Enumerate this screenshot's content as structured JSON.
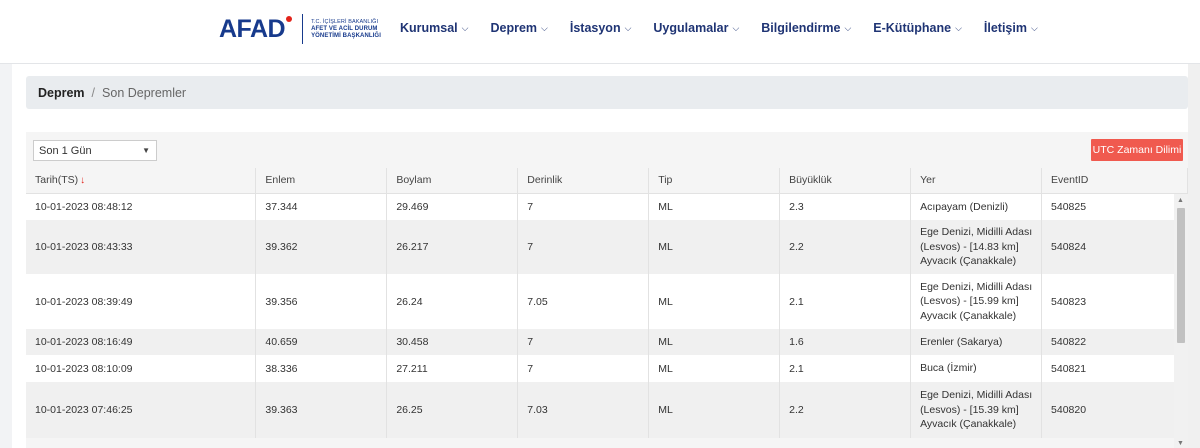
{
  "header": {
    "logo": {
      "mark": "AFAD",
      "line1": "T.C. İÇİŞLERİ BAKANLIĞI",
      "line2": "AFET VE ACİL DURUM",
      "line3": "YÖNETİMİ BAŞKANLIĞI"
    },
    "nav": [
      "Kurumsal",
      "Deprem",
      "İstasyon",
      "Uygulamalar",
      "Bilgilendirme",
      "E-Kütüphane",
      "İletişim"
    ]
  },
  "breadcrumb": {
    "root": "Deprem",
    "separator": "/",
    "current": "Son Depremler"
  },
  "filter": {
    "selected": "Son 1 Gün"
  },
  "utc_button": "UTC Zamanı Dilimi",
  "table": {
    "columns": [
      "Tarih(TS)",
      "Enlem",
      "Boylam",
      "Derinlik",
      "Tip",
      "Büyüklük",
      "Yer",
      "EventID"
    ],
    "rows": [
      {
        "date": "10-01-2023 08:48:12",
        "lat": "37.344",
        "lon": "29.469",
        "depth": "7",
        "type": "ML",
        "mag": "2.3",
        "loc": [
          "Acıpayam (Denizli)"
        ],
        "id": "540825"
      },
      {
        "date": "10-01-2023 08:43:33",
        "lat": "39.362",
        "lon": "26.217",
        "depth": "7",
        "type": "ML",
        "mag": "2.2",
        "loc": [
          "Ege Denizi, Midilli Adası",
          "(Lesvos) - [14.83 km]",
          "Ayvacık (Çanakkale)"
        ],
        "id": "540824"
      },
      {
        "date": "10-01-2023 08:39:49",
        "lat": "39.356",
        "lon": "26.24",
        "depth": "7.05",
        "type": "ML",
        "mag": "2.1",
        "loc": [
          "Ege Denizi, Midilli Adası",
          "(Lesvos) - [15.99 km]",
          "Ayvacık (Çanakkale)"
        ],
        "id": "540823"
      },
      {
        "date": "10-01-2023 08:16:49",
        "lat": "40.659",
        "lon": "30.458",
        "depth": "7",
        "type": "ML",
        "mag": "1.6",
        "loc": [
          "Erenler (Sakarya)"
        ],
        "id": "540822"
      },
      {
        "date": "10-01-2023 08:10:09",
        "lat": "38.336",
        "lon": "27.211",
        "depth": "7",
        "type": "ML",
        "mag": "2.1",
        "loc": [
          "Buca (İzmir)"
        ],
        "id": "540821"
      },
      {
        "date": "10-01-2023 07:46:25",
        "lat": "39.363",
        "lon": "26.25",
        "depth": "7.03",
        "type": "ML",
        "mag": "2.2",
        "loc": [
          "Ege Denizi, Midilli Adası",
          "(Lesvos) - [15.39 km]",
          "Ayvacık (Çanakkale)"
        ],
        "id": "540820"
      }
    ]
  },
  "colors": {
    "brand": "#173a8c",
    "nav": "#1f3474",
    "accent_red": "#f05a4f"
  }
}
